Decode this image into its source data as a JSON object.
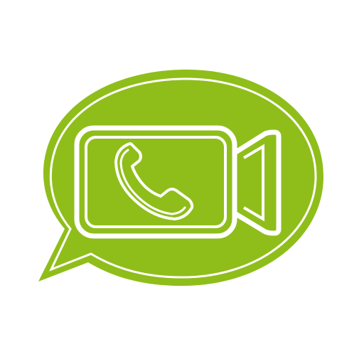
{
  "icon": {
    "name": "video-call-chat-icon",
    "parts": [
      "speech-bubble-icon",
      "video-camera-icon",
      "phone-handset-icon"
    ]
  },
  "colors": {
    "accent": "#8fbe1a",
    "background": "#ffffff",
    "highlight": "#ffffff"
  }
}
